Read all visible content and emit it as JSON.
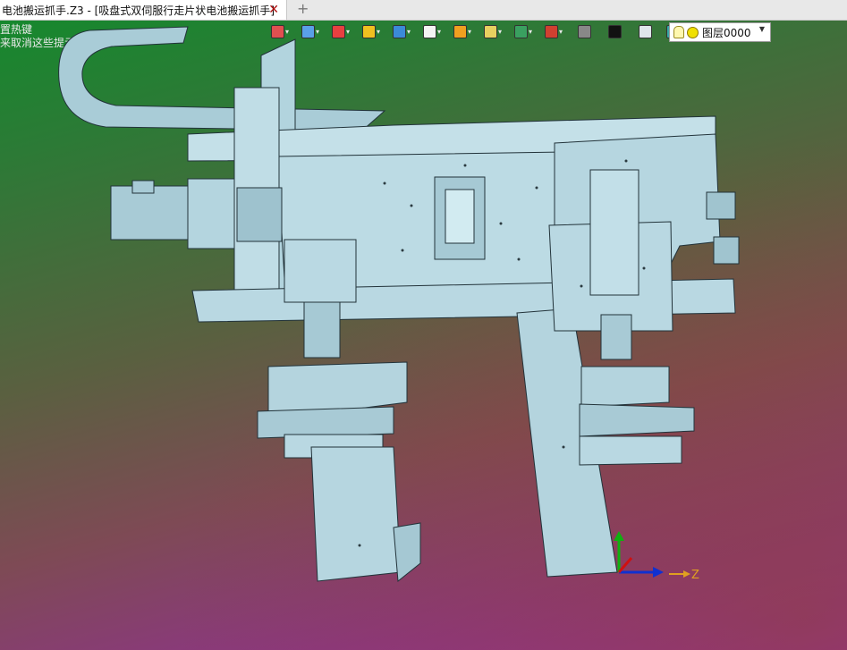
{
  "tab": {
    "title": "电池搬运抓手.Z3 - [吸盘式双伺服行走片状电池搬运抓手]",
    "close_glyph": "✕",
    "new_tab_glyph": "+"
  },
  "hint_lines": [
    "置热键",
    "来取消这些提示。"
  ],
  "toolbar": {
    "items": [
      {
        "name": "view-orient-icon",
        "color": "#e05050"
      },
      {
        "name": "shade-mode-icon",
        "color": "#5aa0e8"
      },
      {
        "name": "pen-icon",
        "color": "#e84040"
      },
      {
        "name": "box-yellow-icon",
        "color": "#f0c020"
      },
      {
        "name": "cube-blue-icon",
        "color": "#3b8ad8"
      },
      {
        "name": "cube-white-icon",
        "color": "#f4f4f4"
      },
      {
        "name": "render-icon",
        "color": "#f0a020"
      },
      {
        "name": "zoom-icon",
        "color": "#e8d060"
      },
      {
        "name": "refresh-view-icon",
        "color": "#3aa060"
      },
      {
        "name": "section-icon",
        "color": "#d04030"
      },
      {
        "name": "display-icon",
        "color": "#888888"
      },
      {
        "name": "line-color-icon",
        "color": "#111111"
      },
      {
        "name": "fill-color-icon",
        "color": "#dfe6ea"
      },
      {
        "name": "layers-icon",
        "color": "#38a8a8"
      }
    ],
    "layer_value": "图层0000"
  },
  "axes": {
    "z_label": "Z"
  }
}
